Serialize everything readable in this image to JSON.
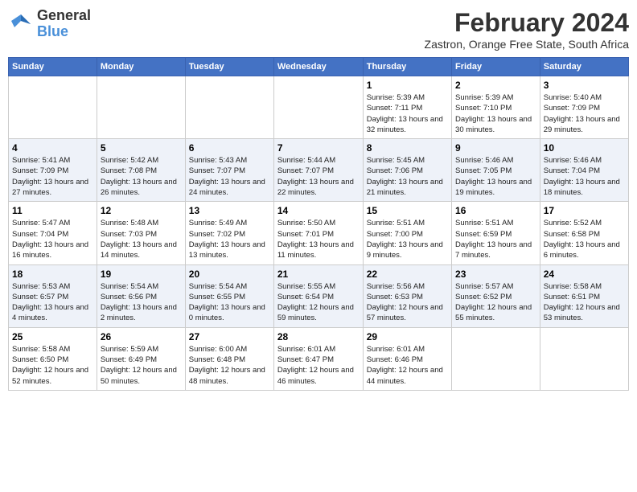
{
  "header": {
    "logo": {
      "line1": "General",
      "line2": "Blue"
    },
    "title": "February 2024",
    "subtitle": "Zastron, Orange Free State, South Africa"
  },
  "days_of_week": [
    "Sunday",
    "Monday",
    "Tuesday",
    "Wednesday",
    "Thursday",
    "Friday",
    "Saturday"
  ],
  "weeks": [
    [
      {
        "day": "",
        "info": ""
      },
      {
        "day": "",
        "info": ""
      },
      {
        "day": "",
        "info": ""
      },
      {
        "day": "",
        "info": ""
      },
      {
        "day": "1",
        "info": "Sunrise: 5:39 AM\nSunset: 7:11 PM\nDaylight: 13 hours and 32 minutes."
      },
      {
        "day": "2",
        "info": "Sunrise: 5:39 AM\nSunset: 7:10 PM\nDaylight: 13 hours and 30 minutes."
      },
      {
        "day": "3",
        "info": "Sunrise: 5:40 AM\nSunset: 7:09 PM\nDaylight: 13 hours and 29 minutes."
      }
    ],
    [
      {
        "day": "4",
        "info": "Sunrise: 5:41 AM\nSunset: 7:09 PM\nDaylight: 13 hours and 27 minutes."
      },
      {
        "day": "5",
        "info": "Sunrise: 5:42 AM\nSunset: 7:08 PM\nDaylight: 13 hours and 26 minutes."
      },
      {
        "day": "6",
        "info": "Sunrise: 5:43 AM\nSunset: 7:07 PM\nDaylight: 13 hours and 24 minutes."
      },
      {
        "day": "7",
        "info": "Sunrise: 5:44 AM\nSunset: 7:07 PM\nDaylight: 13 hours and 22 minutes."
      },
      {
        "day": "8",
        "info": "Sunrise: 5:45 AM\nSunset: 7:06 PM\nDaylight: 13 hours and 21 minutes."
      },
      {
        "day": "9",
        "info": "Sunrise: 5:46 AM\nSunset: 7:05 PM\nDaylight: 13 hours and 19 minutes."
      },
      {
        "day": "10",
        "info": "Sunrise: 5:46 AM\nSunset: 7:04 PM\nDaylight: 13 hours and 18 minutes."
      }
    ],
    [
      {
        "day": "11",
        "info": "Sunrise: 5:47 AM\nSunset: 7:04 PM\nDaylight: 13 hours and 16 minutes."
      },
      {
        "day": "12",
        "info": "Sunrise: 5:48 AM\nSunset: 7:03 PM\nDaylight: 13 hours and 14 minutes."
      },
      {
        "day": "13",
        "info": "Sunrise: 5:49 AM\nSunset: 7:02 PM\nDaylight: 13 hours and 13 minutes."
      },
      {
        "day": "14",
        "info": "Sunrise: 5:50 AM\nSunset: 7:01 PM\nDaylight: 13 hours and 11 minutes."
      },
      {
        "day": "15",
        "info": "Sunrise: 5:51 AM\nSunset: 7:00 PM\nDaylight: 13 hours and 9 minutes."
      },
      {
        "day": "16",
        "info": "Sunrise: 5:51 AM\nSunset: 6:59 PM\nDaylight: 13 hours and 7 minutes."
      },
      {
        "day": "17",
        "info": "Sunrise: 5:52 AM\nSunset: 6:58 PM\nDaylight: 13 hours and 6 minutes."
      }
    ],
    [
      {
        "day": "18",
        "info": "Sunrise: 5:53 AM\nSunset: 6:57 PM\nDaylight: 13 hours and 4 minutes."
      },
      {
        "day": "19",
        "info": "Sunrise: 5:54 AM\nSunset: 6:56 PM\nDaylight: 13 hours and 2 minutes."
      },
      {
        "day": "20",
        "info": "Sunrise: 5:54 AM\nSunset: 6:55 PM\nDaylight: 13 hours and 0 minutes."
      },
      {
        "day": "21",
        "info": "Sunrise: 5:55 AM\nSunset: 6:54 PM\nDaylight: 12 hours and 59 minutes."
      },
      {
        "day": "22",
        "info": "Sunrise: 5:56 AM\nSunset: 6:53 PM\nDaylight: 12 hours and 57 minutes."
      },
      {
        "day": "23",
        "info": "Sunrise: 5:57 AM\nSunset: 6:52 PM\nDaylight: 12 hours and 55 minutes."
      },
      {
        "day": "24",
        "info": "Sunrise: 5:58 AM\nSunset: 6:51 PM\nDaylight: 12 hours and 53 minutes."
      }
    ],
    [
      {
        "day": "25",
        "info": "Sunrise: 5:58 AM\nSunset: 6:50 PM\nDaylight: 12 hours and 52 minutes."
      },
      {
        "day": "26",
        "info": "Sunrise: 5:59 AM\nSunset: 6:49 PM\nDaylight: 12 hours and 50 minutes."
      },
      {
        "day": "27",
        "info": "Sunrise: 6:00 AM\nSunset: 6:48 PM\nDaylight: 12 hours and 48 minutes."
      },
      {
        "day": "28",
        "info": "Sunrise: 6:01 AM\nSunset: 6:47 PM\nDaylight: 12 hours and 46 minutes."
      },
      {
        "day": "29",
        "info": "Sunrise: 6:01 AM\nSunset: 6:46 PM\nDaylight: 12 hours and 44 minutes."
      },
      {
        "day": "",
        "info": ""
      },
      {
        "day": "",
        "info": ""
      }
    ]
  ]
}
